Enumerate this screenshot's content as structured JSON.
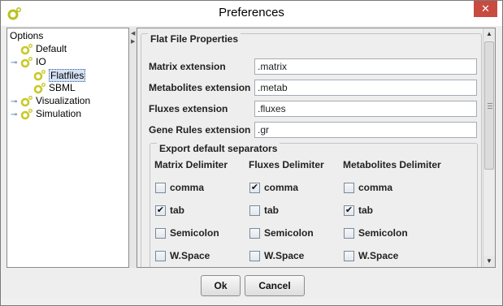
{
  "window": {
    "title": "Preferences",
    "close_glyph": "✕"
  },
  "tree": {
    "root_label": "Options",
    "items": [
      {
        "label": "Default",
        "handle": "",
        "icon": "gear-icon"
      },
      {
        "label": "IO",
        "handle": "⊸",
        "icon": "gear-icon"
      },
      {
        "label": "Flatfiles",
        "handle": "",
        "icon": "gear-icon",
        "selected": true
      },
      {
        "label": "SBML",
        "handle": "",
        "icon": "gear-icon"
      },
      {
        "label": "Visualization",
        "handle": "⊸",
        "icon": "gear-icon"
      },
      {
        "label": "Simulation",
        "handle": "⊸",
        "icon": "gear-icon"
      }
    ]
  },
  "panel": {
    "legend": "Flat File Properties",
    "fields": [
      {
        "label": "Matrix extension",
        "value": ".matrix"
      },
      {
        "label": "Metabolites extension",
        "value": ".metab"
      },
      {
        "label": "Fluxes extension",
        "value": ".fluxes"
      },
      {
        "label": "Gene Rules extension",
        "value": ".gr"
      }
    ],
    "separators": {
      "legend": "Export default separators",
      "columns": [
        "Matrix Delimiter",
        "Fluxes Delimiter",
        "Metabolites Delimiter"
      ],
      "options": [
        "comma",
        "tab",
        "Semicolon",
        "W.Space"
      ],
      "checked": [
        [
          false,
          true,
          false,
          false
        ],
        [
          true,
          false,
          false,
          false
        ],
        [
          false,
          true,
          false,
          false
        ]
      ]
    }
  },
  "buttons": {
    "ok": "Ok",
    "cancel": "Cancel"
  },
  "colors": {
    "accent_green": "#c9c92a",
    "selection": "#d6e2f5",
    "close": "#c74b3f"
  }
}
